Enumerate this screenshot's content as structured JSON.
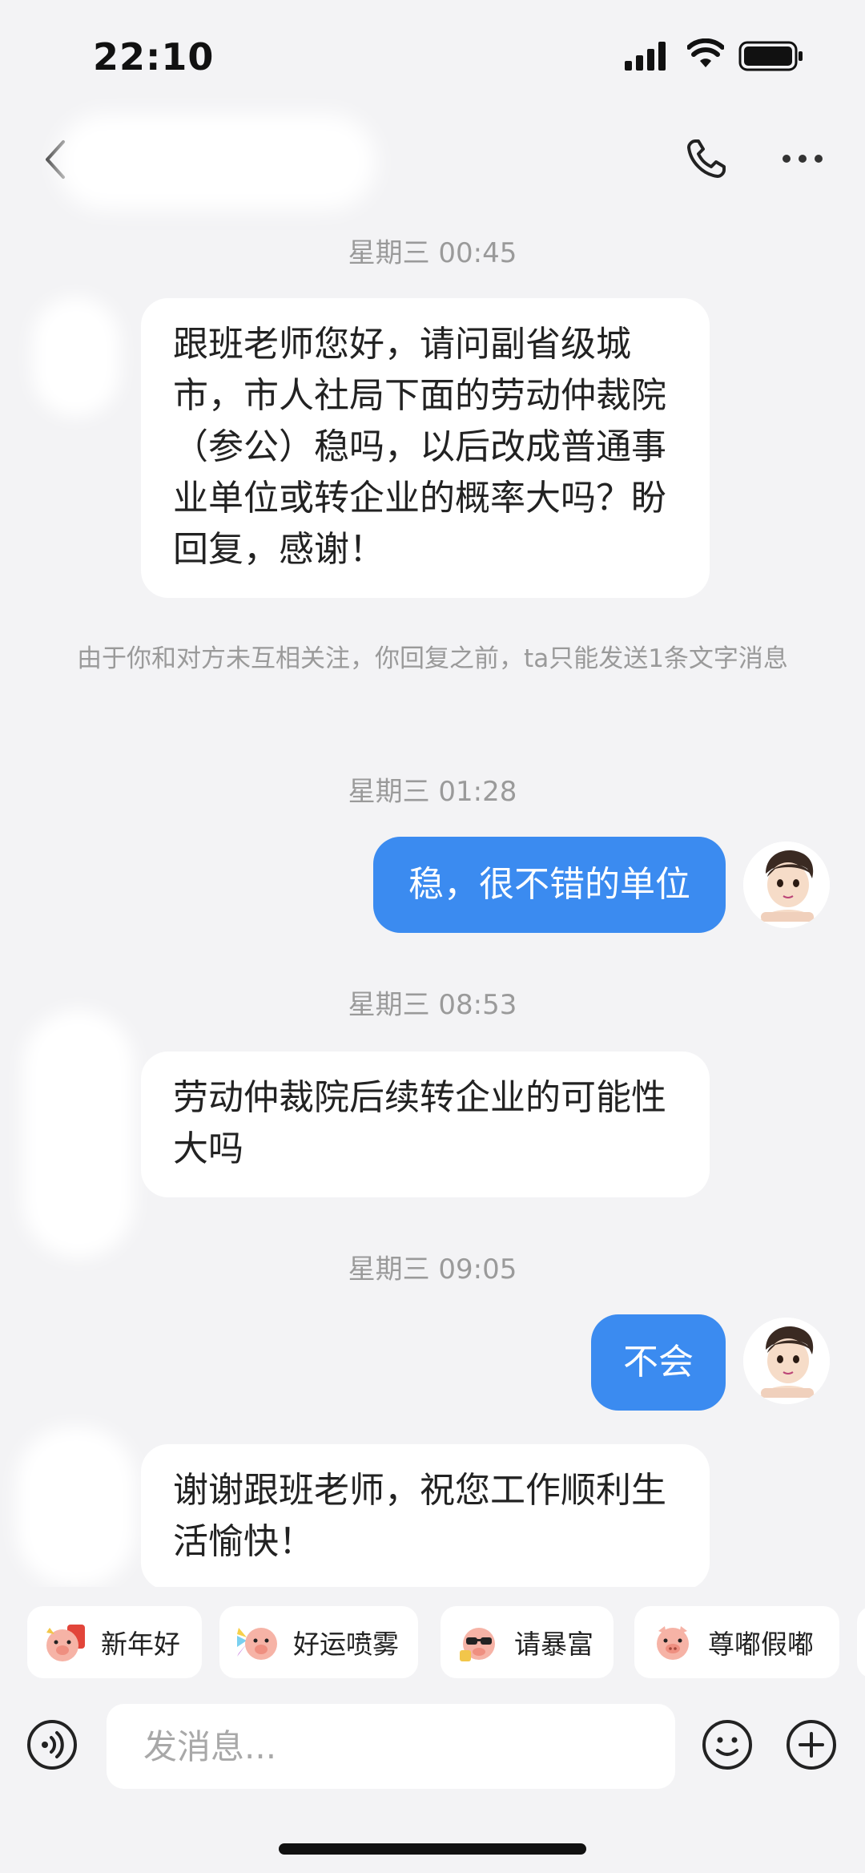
{
  "status": {
    "time": "22:10"
  },
  "header": {
    "contact_name": ""
  },
  "messages": [
    {
      "type": "timestamp",
      "text": "星期三 00:45"
    },
    {
      "type": "incoming",
      "text": "跟班老师您好，请问副省级城市，市人社局下面的劳动仲裁院（参公）稳吗，以后改成普通事业单位或转企业的概率大吗？盼回复，感谢！"
    },
    {
      "type": "system",
      "text": "由于你和对方未互相关注，你回复之前，ta只能发送1条文字消息"
    },
    {
      "type": "timestamp",
      "text": "星期三 01:28"
    },
    {
      "type": "outgoing",
      "text": "稳，很不错的单位"
    },
    {
      "type": "timestamp",
      "text": "星期三 08:53"
    },
    {
      "type": "incoming",
      "text": "劳动仲裁院后续转企业的可能性大吗"
    },
    {
      "type": "timestamp",
      "text": "星期三 09:05"
    },
    {
      "type": "outgoing",
      "text": "不会"
    },
    {
      "type": "incoming",
      "text": "谢谢跟班老师，祝您工作顺利生活愉快！"
    }
  ],
  "stickers": [
    {
      "label": "新年好",
      "icon": "pig-newyear-icon"
    },
    {
      "label": "好运喷雾",
      "icon": "pig-spray-icon"
    },
    {
      "label": "请暴富",
      "icon": "pig-sunglasses-icon"
    },
    {
      "label": "尊嘟假嘟",
      "icon": "pig-face-icon"
    }
  ],
  "input": {
    "placeholder": "发消息..."
  },
  "colors": {
    "outgoing_bubble": "#3b8bf0",
    "incoming_bubble": "#ffffff",
    "background": "#f3f3f5"
  },
  "icons": [
    "back-icon",
    "phone-icon",
    "more-icon",
    "voice-icon",
    "emoji-icon",
    "plus-icon",
    "signal-icon",
    "wifi-icon",
    "battery-icon"
  ]
}
